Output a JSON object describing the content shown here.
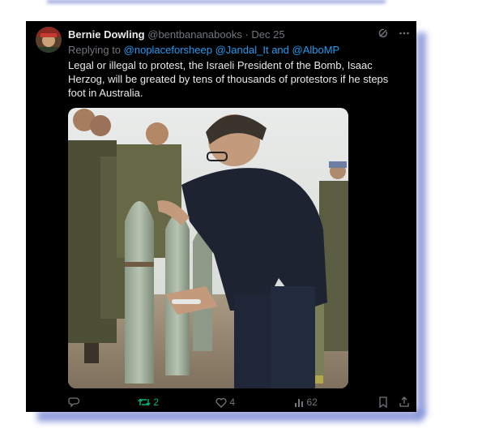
{
  "tweet": {
    "author_name": "Bernie Dowling",
    "handle": "@bentbananabooks",
    "separator": "·",
    "date": "Dec 25",
    "replying_prefix": "Replying to ",
    "reply_handle_1": "@noplaceforsheep",
    "reply_handle_2": "@Jandal_It",
    "reply_and": " and ",
    "reply_handle_3": "@AlboMP",
    "text": "Legal or illegal to protest, the Israeli President of the Bomb, Isaac Herzog, will be greated by tens of thousands of protestors if he steps foot in Australia."
  },
  "actions": {
    "replies": "",
    "retweets": "2",
    "likes": "4",
    "views": "62"
  },
  "icons": [
    "grok-icon",
    "more-icon",
    "reply-icon",
    "retweet-icon",
    "like-icon",
    "views-icon",
    "bookmark-icon",
    "share-icon"
  ],
  "colors": {
    "background": "#000000",
    "text": "#e7e9ea",
    "muted": "#71767b",
    "link": "#1d9bf0",
    "retweet": "#00ba7c",
    "frame_shadow": "#7887d4"
  }
}
